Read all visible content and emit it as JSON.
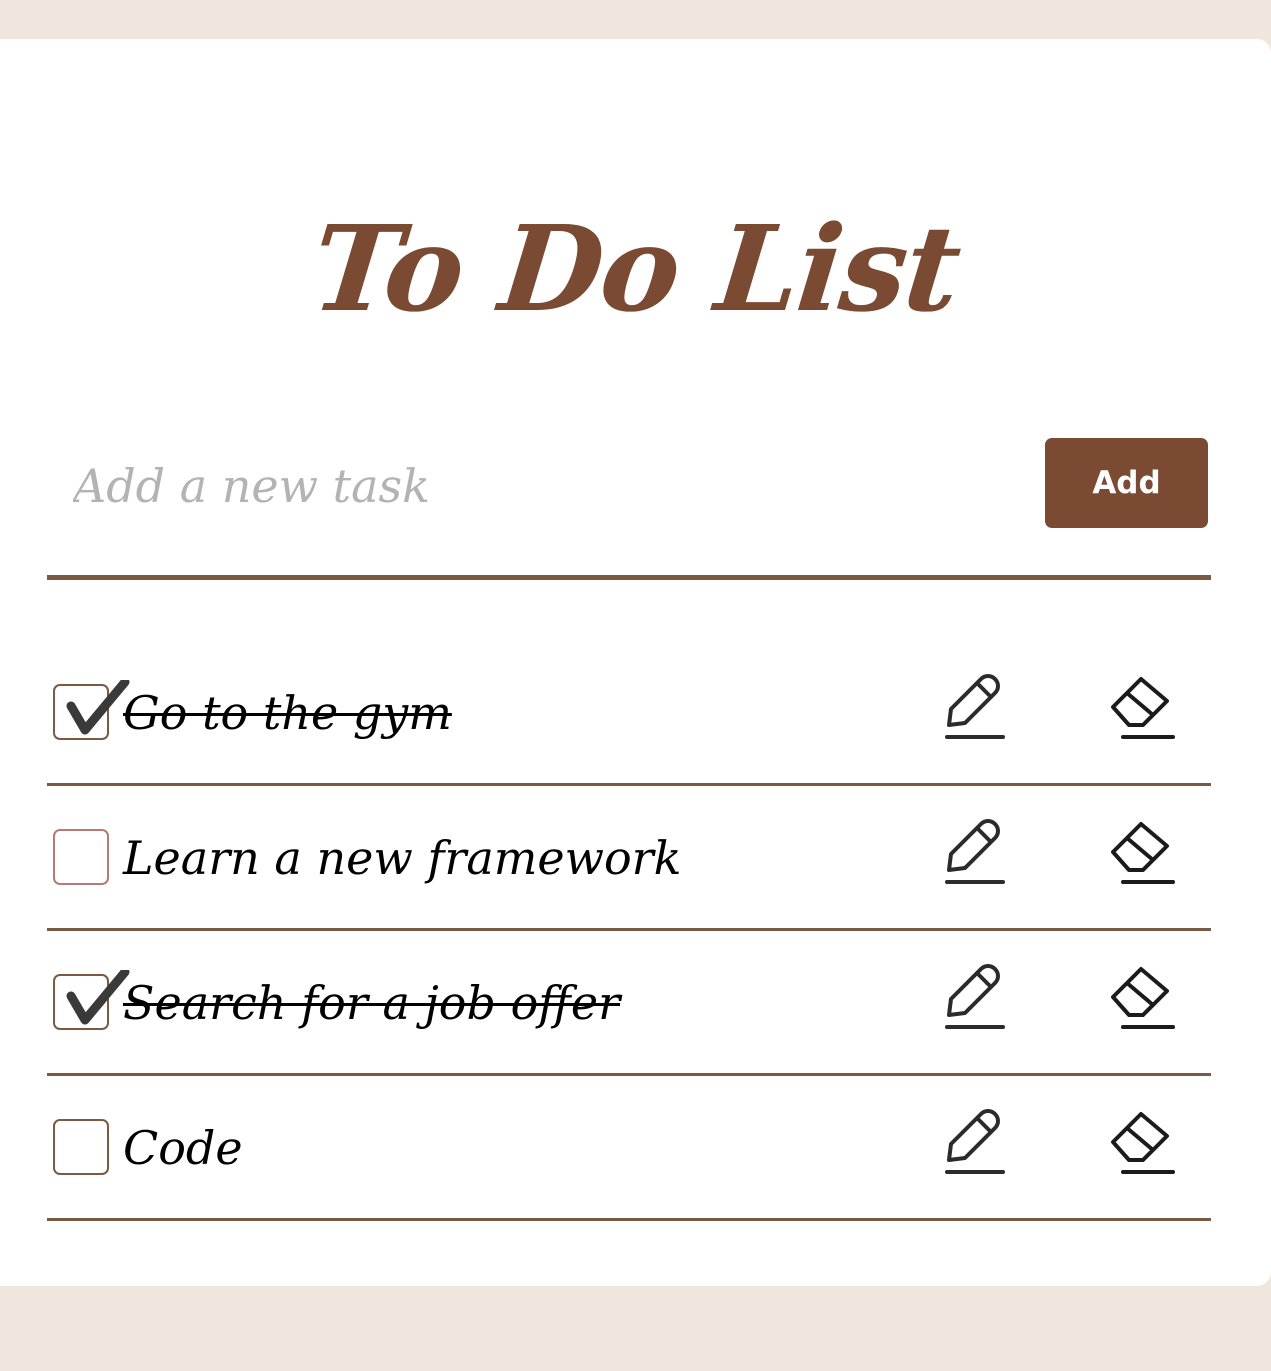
{
  "app": {
    "title": "To Do List"
  },
  "new_task": {
    "placeholder": "Add a new task",
    "value": "",
    "add_label": "Add"
  },
  "tasks": [
    {
      "text": "Go to the gym",
      "completed": true
    },
    {
      "text": "Learn a new framework",
      "completed": false
    },
    {
      "text": "Search for a job offer",
      "completed": true
    },
    {
      "text": "Code",
      "completed": false
    }
  ],
  "icons": {
    "edit": "pencil-icon",
    "delete": "eraser-icon",
    "check": "checkmark-icon"
  },
  "colors": {
    "accent": "#7a4a33",
    "background": "#efe6de",
    "card": "#ffffff",
    "divider": "#7a5a43"
  }
}
